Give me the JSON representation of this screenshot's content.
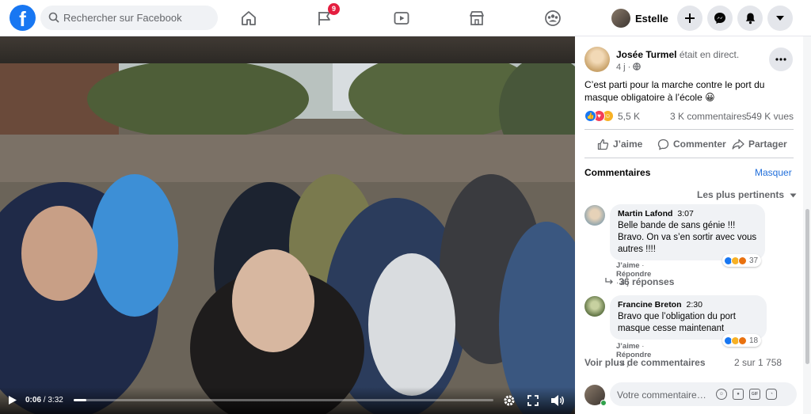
{
  "topbar": {
    "logo": "f",
    "search_placeholder": "Rechercher sur Facebook",
    "notification_count": "9",
    "profile_name": "Estelle"
  },
  "video": {
    "current_time": "0:06",
    "duration": "3:32",
    "progress_fraction": 0.03
  },
  "post": {
    "author": "Josée Turmel",
    "status": "était en direct.",
    "time": "4 j",
    "text": "C’est parti pour la marche contre le port du masque obligatoire à l’école 😀",
    "reaction_count": "5,5 K",
    "comment_count": "3 K commentaires",
    "view_count": "549 K vues",
    "actions": {
      "like": "J’aime",
      "comment": "Commenter",
      "share": "Partager"
    }
  },
  "comments_section": {
    "title": "Commentaires",
    "hide_label": "Masquer",
    "sort_label": "Les plus pertinents",
    "items": [
      {
        "name": "Martin Lafond",
        "time": "3:07",
        "text": "Belle bande de sans génie !!! Bravo. On va s’en sortir avec vous autres !!!!",
        "like_label": "J’aime",
        "reply_label": "Répondre",
        "age": "4 j",
        "reaction_count": "37"
      },
      {
        "name": "Francine Breton",
        "time": "2:30",
        "text": "Bravo que l’obligation du port masque cesse maintenant",
        "like_label": "J’aime",
        "reply_label": "Répondre",
        "age": "4 j",
        "reaction_count": "18"
      }
    ],
    "replies_label": "36 réponses",
    "view_more_label": "Voir plus de commentaires",
    "pager": "2 sur 1 758",
    "composer_placeholder": "Votre commentaire…"
  },
  "colors": {
    "brand": "#1877f2",
    "link": "#216fdb",
    "badge": "#e41e3f",
    "secondary_text": "#65676b",
    "online": "#31a24c"
  },
  "icons": [
    "search-icon",
    "home-icon",
    "flag-icon",
    "watch-icon",
    "marketplace-icon",
    "groups-icon",
    "plus-icon",
    "messenger-icon",
    "bell-icon",
    "caret-down-icon",
    "globe-icon",
    "more-icon",
    "like-icon",
    "comment-icon",
    "share-icon",
    "play-icon",
    "settings-icon",
    "fullscreen-icon",
    "volume-icon",
    "emoji-icon",
    "camera-icon",
    "gif-icon",
    "sticker-icon"
  ]
}
